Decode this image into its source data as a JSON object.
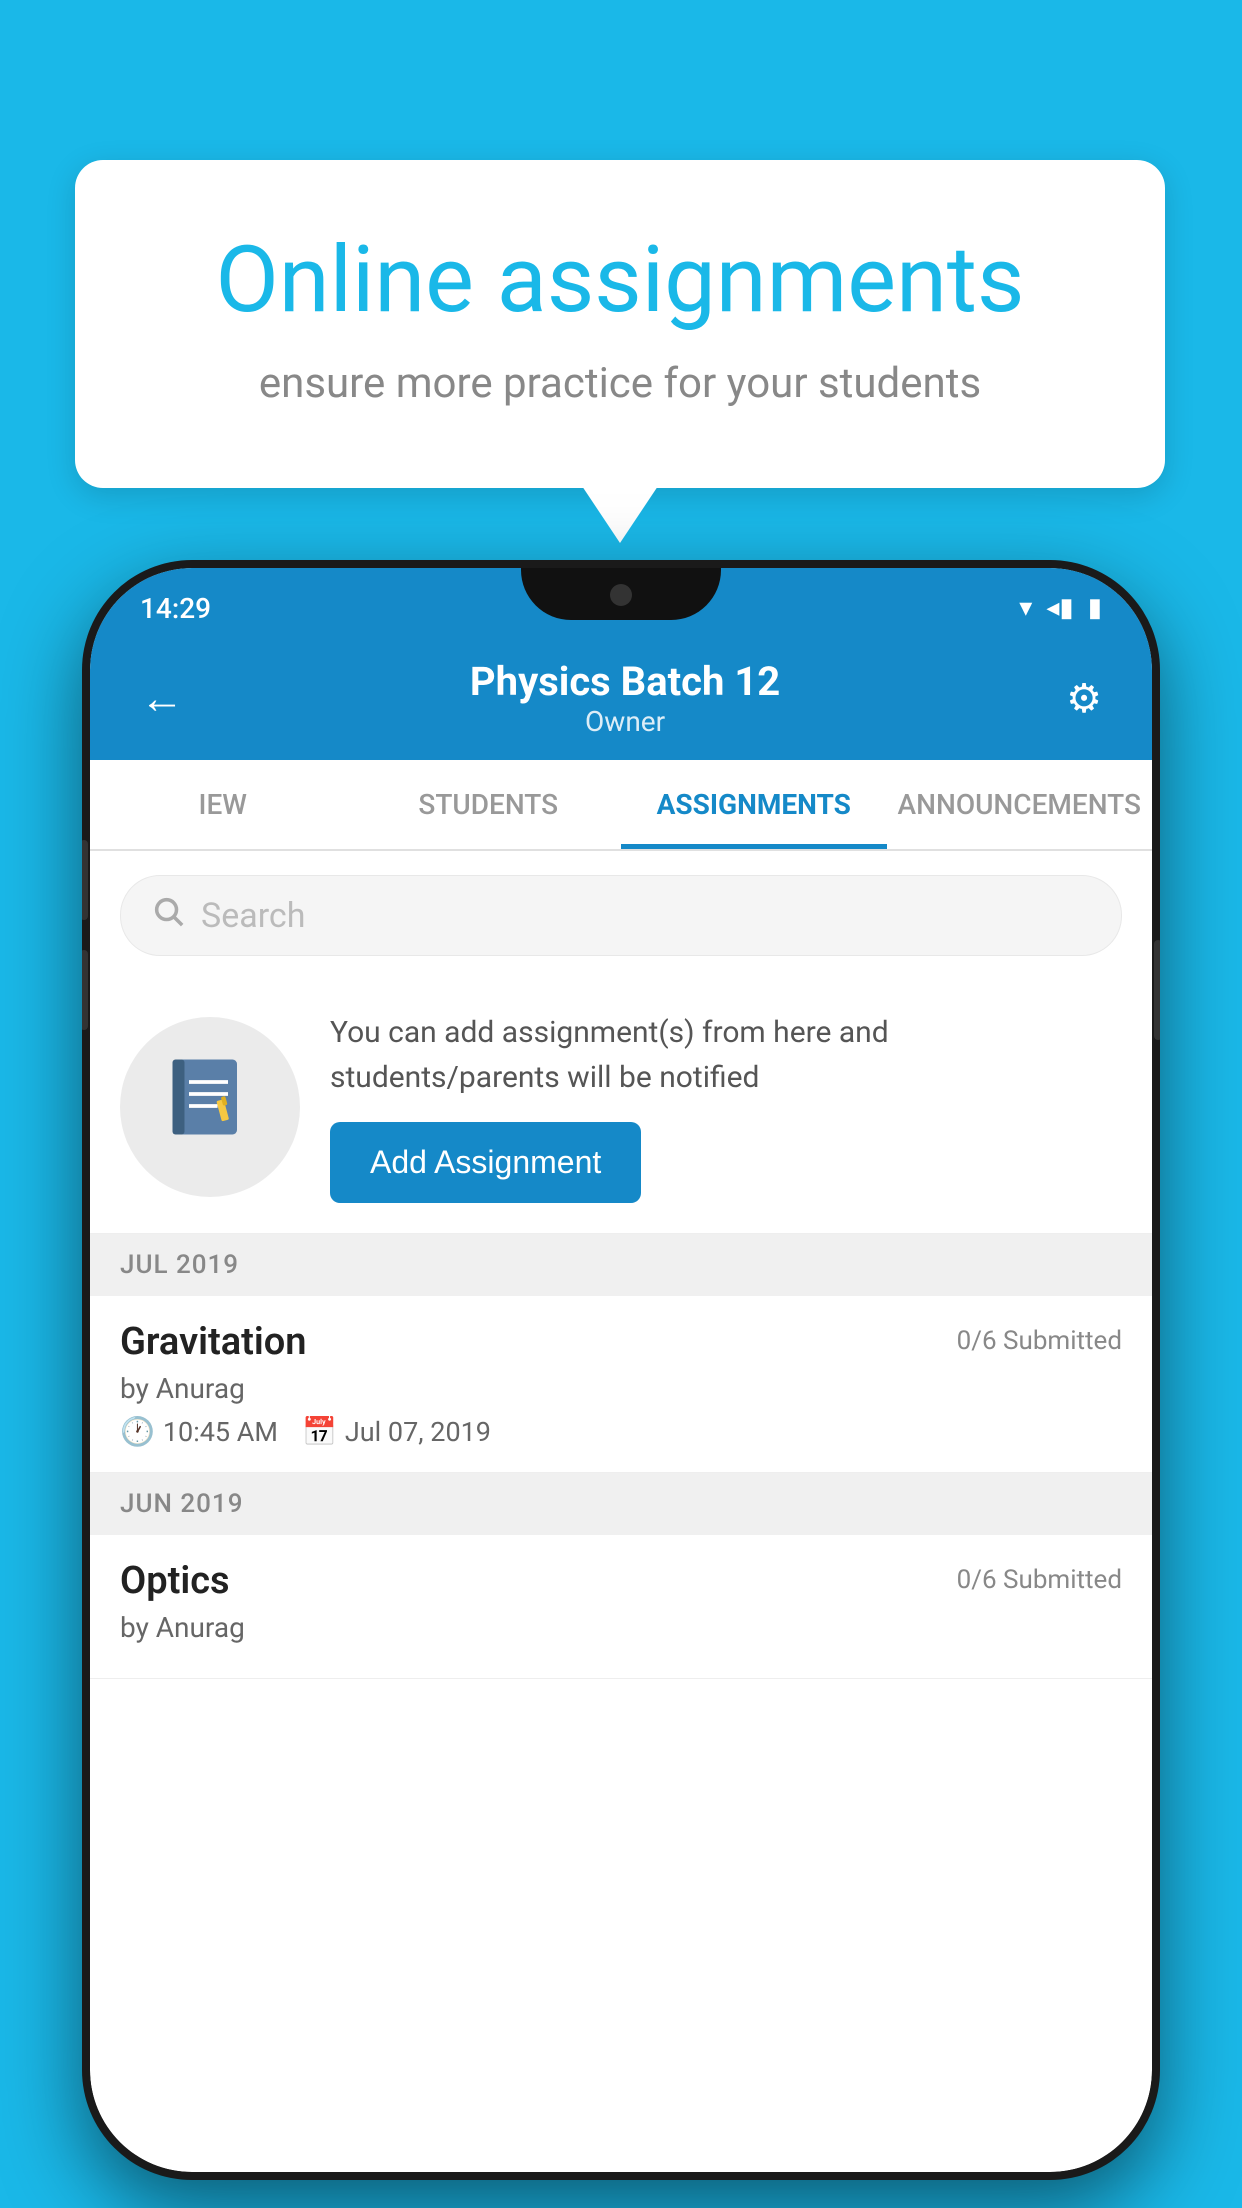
{
  "background": {
    "color": "#1ab8e8"
  },
  "speech_bubble": {
    "title": "Online assignments",
    "subtitle": "ensure more practice for your students"
  },
  "phone": {
    "status_bar": {
      "time": "14:29",
      "wifi": "▾",
      "signal": "◂",
      "battery": "▮"
    },
    "header": {
      "back_label": "←",
      "title": "Physics Batch 12",
      "subtitle": "Owner",
      "settings_label": "⚙"
    },
    "tabs": [
      {
        "label": "IEW",
        "active": false
      },
      {
        "label": "STUDENTS",
        "active": false
      },
      {
        "label": "ASSIGNMENTS",
        "active": true
      },
      {
        "label": "ANNOUNCEMENTS",
        "active": false
      }
    ],
    "search": {
      "placeholder": "Search"
    },
    "info_box": {
      "text": "You can add assignment(s) from here and students/parents will be notified",
      "button_label": "Add Assignment"
    },
    "sections": [
      {
        "header": "JUL 2019",
        "assignments": [
          {
            "name": "Gravitation",
            "submitted": "0/6 Submitted",
            "by": "by Anurag",
            "time": "10:45 AM",
            "date": "Jul 07, 2019"
          }
        ]
      },
      {
        "header": "JUN 2019",
        "assignments": [
          {
            "name": "Optics",
            "submitted": "0/6 Submitted",
            "by": "by Anurag",
            "time": "",
            "date": ""
          }
        ]
      }
    ]
  }
}
